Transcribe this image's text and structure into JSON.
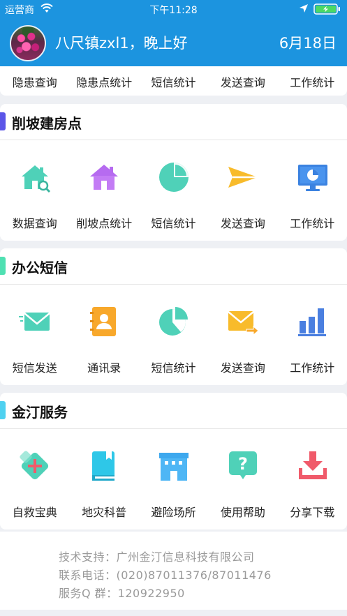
{
  "status_bar": {
    "carrier": "运营商",
    "time": "下午11:28"
  },
  "header": {
    "greeting": "八尺镇zxl1，晚上好",
    "date": "6月18日"
  },
  "quick_row": {
    "items": [
      "隐患查询",
      "隐患点统计",
      "短信统计",
      "发送查询",
      "工作统计"
    ]
  },
  "sections": [
    {
      "title": "削坡建房点",
      "bar_color": "#5b55e8",
      "items": [
        {
          "label": "数据查询",
          "icon": "house-search-icon",
          "color": "#4fd1b8"
        },
        {
          "label": "削坡点统计",
          "icon": "house-icon",
          "color": "#b66bf0"
        },
        {
          "label": "短信统计",
          "icon": "pie-chart-icon",
          "color": "#4fd1b8"
        },
        {
          "label": "发送查询",
          "icon": "send-arrow-icon",
          "color": "#f8bb2b"
        },
        {
          "label": "工作统计",
          "icon": "monitor-chart-icon",
          "color": "#3b82e0"
        }
      ]
    },
    {
      "title": "办公短信",
      "bar_color": "#4fe0b2",
      "items": [
        {
          "label": "短信发送",
          "icon": "envelope-icon",
          "color": "#4fd1b8"
        },
        {
          "label": "通讯录",
          "icon": "contacts-book-icon",
          "color": "#f8a82b"
        },
        {
          "label": "短信统计",
          "icon": "pie-chart-icon",
          "color": "#4fd1b8"
        },
        {
          "label": "发送查询",
          "icon": "mail-forward-icon",
          "color": "#f8bb2b"
        },
        {
          "label": "工作统计",
          "icon": "bar-chart-icon",
          "color": "#4a7fe0"
        }
      ]
    },
    {
      "title": "金汀服务",
      "bar_color": "#4fd1f0",
      "items": [
        {
          "label": "自救宝典",
          "icon": "first-aid-icon",
          "color": "#4fd1b8"
        },
        {
          "label": "地灾科普",
          "icon": "book-icon",
          "color": "#2ec7e8"
        },
        {
          "label": "避险场所",
          "icon": "building-icon",
          "color": "#3da8ee"
        },
        {
          "label": "使用帮助",
          "icon": "help-bubble-icon",
          "color": "#4fd1b8"
        },
        {
          "label": "分享下载",
          "icon": "download-icon",
          "color": "#f05a6a"
        }
      ]
    }
  ],
  "footer": {
    "support": "技术支持：广州金汀信息科技有限公司",
    "phone": "联系电话：(020)87011376/87011476",
    "qq": "服务Q 群：120922950"
  }
}
